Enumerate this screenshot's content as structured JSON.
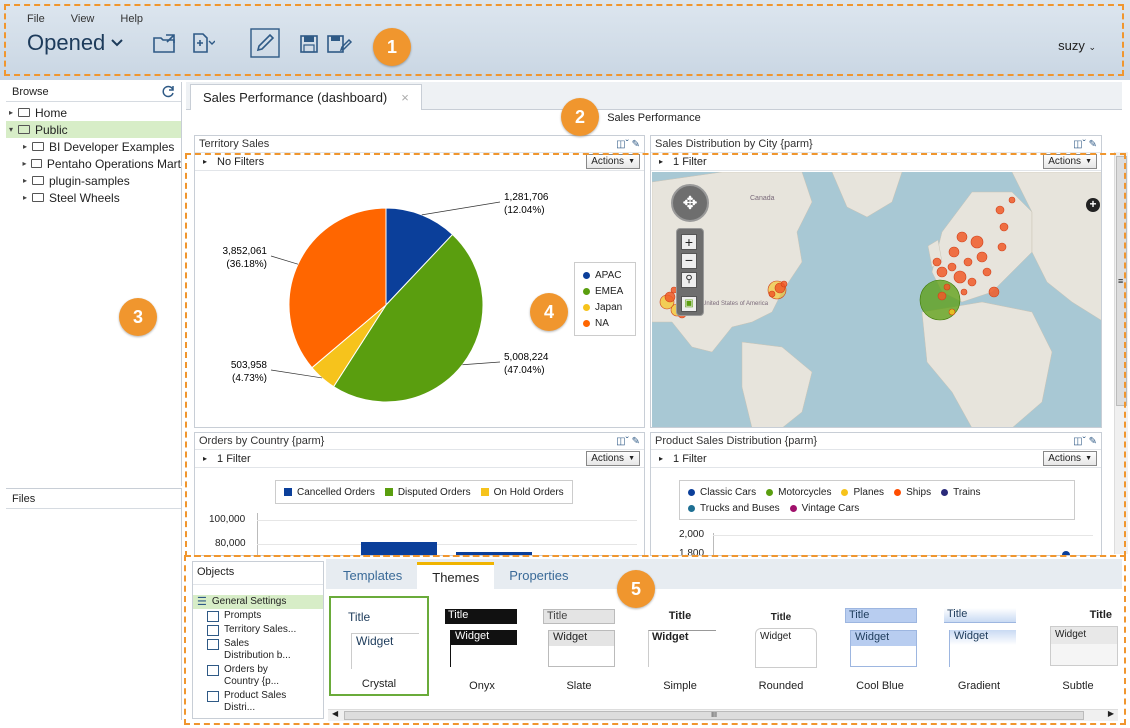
{
  "menu": [
    "File",
    "View",
    "Help"
  ],
  "perspective": "Opened",
  "user": "suzy",
  "badges": [
    "1",
    "2",
    "3",
    "4",
    "5"
  ],
  "browse": {
    "header": "Browse",
    "items": [
      {
        "label": "Home",
        "expanded": false,
        "selected": false,
        "level": 0
      },
      {
        "label": "Public",
        "expanded": true,
        "selected": true,
        "level": 0
      },
      {
        "label": "BI Developer Examples",
        "level": 1
      },
      {
        "label": "Pentaho Operations Mart",
        "level": 1
      },
      {
        "label": "plugin-samples",
        "level": 1
      },
      {
        "label": "Steel Wheels",
        "level": 1
      }
    ]
  },
  "files": {
    "header": "Files"
  },
  "doc_tab": {
    "label": "Sales Performance (dashboard)",
    "close": "×"
  },
  "dashboard_title": "Sales Performance",
  "widgets": {
    "territory": {
      "title": "Territory Sales",
      "filter": "No Filters",
      "actions": "Actions"
    },
    "city": {
      "title": "Sales Distribution by City {parm}",
      "filter": "1 Filter",
      "actions": "Actions"
    },
    "orders": {
      "title": "Orders by Country {parm}",
      "filter": "1 Filter",
      "actions": "Actions"
    },
    "product": {
      "title": "Product Sales Distribution {parm}",
      "filter": "1 Filter",
      "actions": "Actions"
    }
  },
  "chart_data": [
    {
      "type": "pie",
      "title": "Territory Sales",
      "categories": [
        "APAC",
        "EMEA",
        "Japan",
        "NA"
      ],
      "values": [
        1281706,
        5008224,
        503958,
        3852061
      ],
      "labels": [
        "1,281,706",
        "5,008,224",
        "503,958",
        "3,852,061"
      ],
      "percent_labels": [
        "(12.04%)",
        "(47.04%)",
        "(4.73%)",
        "(36.18%)"
      ],
      "colors": [
        "#0b3f9a",
        "#5a9e0f",
        "#f6c31c",
        "#ff6600"
      ],
      "legend": "right"
    },
    {
      "type": "bar",
      "title": "Orders by Country {parm}",
      "legend_entries": [
        "Cancelled Orders",
        "Disputed Orders",
        "On Hold Orders"
      ],
      "legend_colors": [
        "#0b3f9a",
        "#5a9e0f",
        "#f6c31c"
      ],
      "y_ticks": [
        "100,000",
        "80,000"
      ],
      "ylim": [
        0,
        100000
      ],
      "visible_bar_tops": [
        84000,
        81000
      ]
    },
    {
      "type": "bar",
      "title": "Product Sales Distribution {parm}",
      "legend_entries": [
        "Classic Cars",
        "Motorcycles",
        "Planes",
        "Ships",
        "Trains",
        "Trucks and Buses",
        "Vintage Cars"
      ],
      "legend_colors": [
        "#0b3f9a",
        "#5a9e0f",
        "#f6c31c",
        "#ff4d00",
        "#2a2a7a",
        "#1e6f93",
        "#a0106b"
      ],
      "y_ticks": [
        "2,000",
        "1,800"
      ]
    }
  ],
  "map": {
    "labels": [
      "Canada",
      "United States of America"
    ]
  },
  "bottom": {
    "objects_header": "Objects",
    "objects": [
      "General Settings",
      "Prompts",
      "Territory Sales...",
      "Sales Distribution b...",
      "Orders by Country {p...",
      "Product Sales Distri..."
    ],
    "tabs": [
      "Templates",
      "Themes",
      "Properties"
    ],
    "active_tab": "Themes",
    "themes": [
      {
        "name": "Crystal",
        "title": "Title",
        "widget": "Widget"
      },
      {
        "name": "Onyx",
        "title": "Title",
        "widget": "Widget"
      },
      {
        "name": "Slate",
        "title": "Title",
        "widget": "Widget"
      },
      {
        "name": "Simple",
        "title": "Title",
        "widget": "Widget"
      },
      {
        "name": "Rounded",
        "title": "Title",
        "widget": "Widget"
      },
      {
        "name": "Cool Blue",
        "title": "Title",
        "widget": "Widget"
      },
      {
        "name": "Gradient",
        "title": "Title",
        "widget": "Widget"
      },
      {
        "name": "Subtle",
        "title": "Title",
        "widget": "Widget"
      }
    ],
    "scroll_grip": "III"
  },
  "colors": {
    "accent": "#f0962e",
    "link": "#3a6a98",
    "selection": "#d7edc7"
  }
}
